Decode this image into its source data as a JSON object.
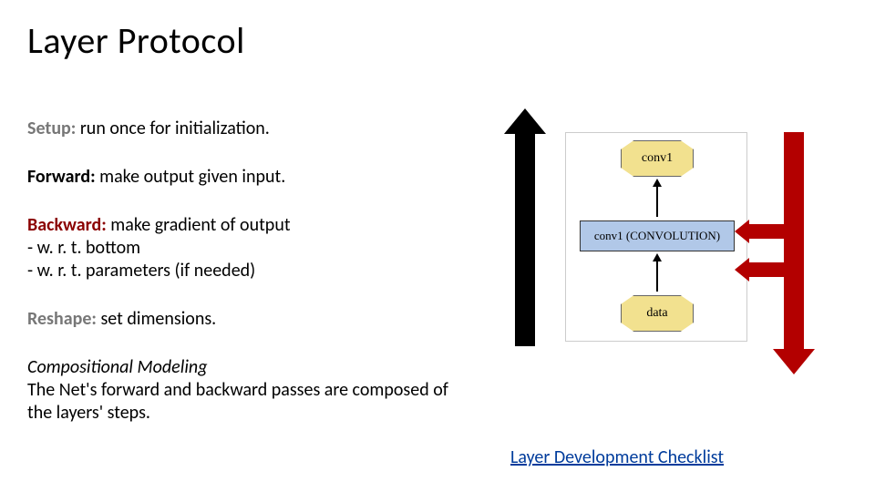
{
  "title": "Layer Protocol",
  "sections": {
    "setup": {
      "label": "Setup:",
      "text": " run once for initialization."
    },
    "forward": {
      "label": "Forward:",
      "text": " make output given input."
    },
    "backward": {
      "label": "Backward:",
      "text": " make gradient of output",
      "b1": "- w. r. t. bottom",
      "b2": "- w. r. t. parameters (if needed)"
    },
    "reshape": {
      "label": "Reshape:",
      "text": " set dimensions."
    },
    "comp": {
      "heading": "Compositional Modeling",
      "body": "The Net's forward and backward passes are composed of the layers' steps."
    }
  },
  "diagram": {
    "top_node": "conv1",
    "mid_node": "conv1 (CONVOLUTION)",
    "bot_node": "data"
  },
  "link": "Layer Development Checklist",
  "colors": {
    "red": "#b30000",
    "black": "#000000",
    "oct_fill": "#f2e18f",
    "rect_fill": "#b1c8e8",
    "link": "#003c9c"
  }
}
